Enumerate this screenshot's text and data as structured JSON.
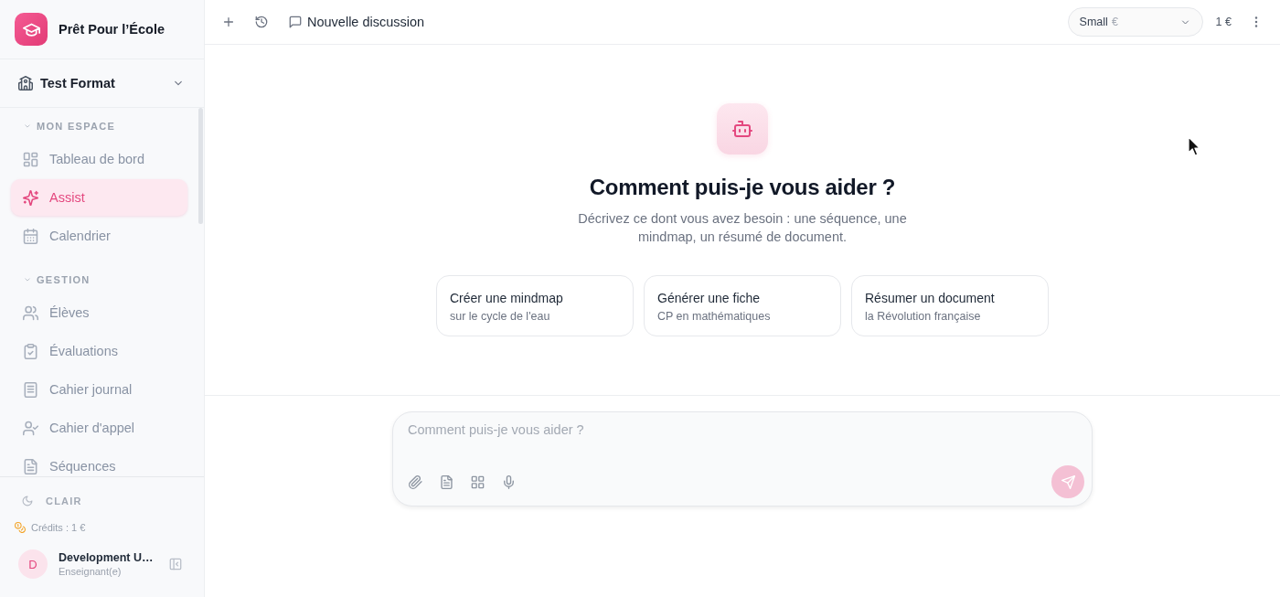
{
  "app": {
    "name": "Prêt Pour l’École"
  },
  "workspace": {
    "name": "Test Format"
  },
  "sidebar": {
    "sections": [
      {
        "title": "MON ESPACE",
        "expanded": true,
        "items": [
          {
            "label": "Tableau de bord",
            "selected": false
          },
          {
            "label": "Assist",
            "selected": true
          },
          {
            "label": "Calendrier",
            "selected": false
          }
        ]
      },
      {
        "title": "GESTION",
        "expanded": true,
        "items": [
          {
            "label": "Élèves",
            "selected": false
          },
          {
            "label": "Évaluations",
            "selected": false
          },
          {
            "label": "Cahier journal",
            "selected": false
          },
          {
            "label": "Cahier d'appel",
            "selected": false
          },
          {
            "label": "Séquences",
            "selected": false
          }
        ]
      }
    ],
    "theme": {
      "label": "CLAIR"
    },
    "credits": "Crédits : 1 €",
    "user": {
      "initial": "D",
      "name": "Development U…",
      "role": "Enseignant(e)"
    }
  },
  "header": {
    "title": "Nouvelle discussion",
    "model": {
      "label": "Small",
      "price": "€"
    },
    "balance": "1 €"
  },
  "hero": {
    "title": "Comment puis-je vous aider ?",
    "subtitle": "Décrivez ce dont vous avez besoin : une séquence, une mindmap, un résumé de document.",
    "suggestions": [
      {
        "title": "Créer une mindmap",
        "subtitle": "sur le cycle de l'eau"
      },
      {
        "title": "Générer une fiche",
        "subtitle": "CP en mathématiques"
      },
      {
        "title": "Résumer un document",
        "subtitle": "la Révolution française"
      }
    ]
  },
  "composer": {
    "placeholder": "Comment puis-je vous aider ?",
    "send_disabled": true
  }
}
